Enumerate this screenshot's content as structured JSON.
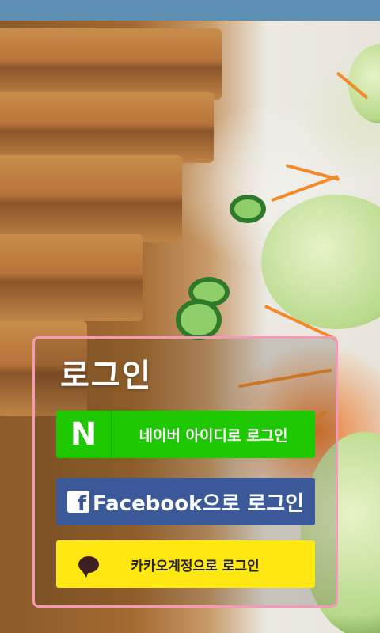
{
  "login": {
    "title": "로그인",
    "naver": {
      "label": "네이버 아이디로 로그인",
      "icon": "naver-n-icon",
      "icon_text": "N",
      "color": "#1ec800"
    },
    "facebook": {
      "label": "Facebook으로 로그인",
      "icon": "facebook-icon",
      "icon_text": "f",
      "color": "#3b5998"
    },
    "kakao": {
      "label": "카카오계정으로 로그인",
      "icon": "kakao-speech-bubble-icon",
      "color": "#ffe812"
    }
  },
  "colors": {
    "statusbar": "#5b8fb4",
    "box_border": "#f29ab8"
  }
}
